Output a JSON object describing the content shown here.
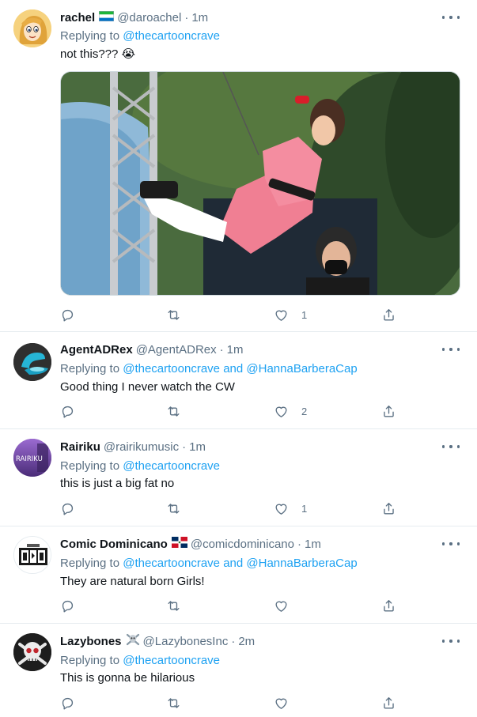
{
  "tweets": [
    {
      "name": "rachel",
      "handle": "@daroachel",
      "time": "1m",
      "flag": "sierra-leone-flag",
      "reply_prefix": "Replying to",
      "reply_to": "@thecartooncrave",
      "reply_and": "",
      "reply_to2": "",
      "text": "not this??? 😭",
      "likes": "1",
      "has_media": true
    },
    {
      "name": "AgentADRex",
      "handle": "@AgentADRex",
      "time": "1m",
      "reply_prefix": "Replying to",
      "reply_to": "@thecartooncrave",
      "reply_and": "and",
      "reply_to2": "@HannaBarberaCap",
      "text": "Good thing I never watch the CW",
      "likes": "2"
    },
    {
      "name": "Rairiku",
      "handle": "@rairikumusic",
      "time": "1m",
      "avatar_text": "RAIRIKU",
      "reply_prefix": "Replying to",
      "reply_to": "@thecartooncrave",
      "reply_and": "",
      "reply_to2": "",
      "text": "this is just a big fat no",
      "likes": "1"
    },
    {
      "name": "Comic Dominicano",
      "handle": "@comicdominicano",
      "time": "1m",
      "flag": "dominican-republic-flag",
      "reply_prefix": "Replying to",
      "reply_to": "@thecartooncrave",
      "reply_and": "and",
      "reply_to2": "@HannaBarberaCap",
      "text": "They are natural born Girls!",
      "likes": ""
    },
    {
      "name": "Lazybones",
      "handle": "@LazybonesInc",
      "time": "2m",
      "flag": "skull-crossbones-emoji",
      "reply_prefix": "Replying to",
      "reply_to": "@thecartooncrave",
      "reply_and": "",
      "reply_to2": "",
      "text": "This is gonna be hilarious",
      "likes": ""
    }
  ],
  "separator": "·",
  "colors": {
    "link": "#1da1f2",
    "secondary": "#5b7083",
    "divider": "#e6ecf0"
  }
}
